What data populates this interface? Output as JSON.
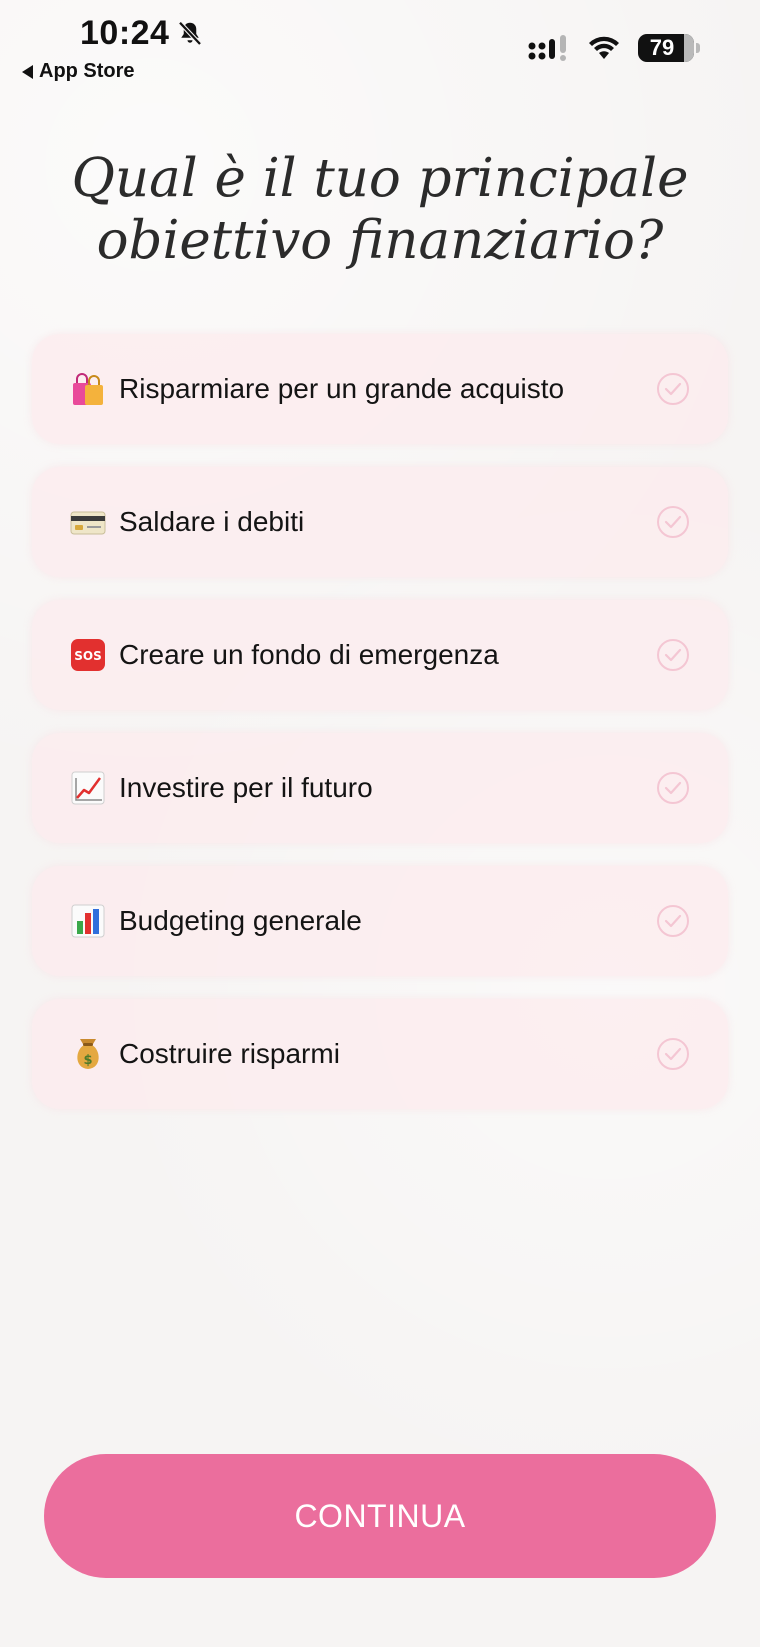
{
  "status_bar": {
    "time": "10:24",
    "back_label": "App Store",
    "battery": "79"
  },
  "title": "Qual è il tuo principale obiettivo finanziario?",
  "options": [
    {
      "emoji": "shopping-bags-icon",
      "label": "Risparmiare per un grande acquisto"
    },
    {
      "emoji": "credit-card-icon",
      "label": "Saldare i debiti"
    },
    {
      "emoji": "sos-icon",
      "label": "Creare un fondo di emergenza"
    },
    {
      "emoji": "chart-increasing-icon",
      "label": "Investire per il futuro"
    },
    {
      "emoji": "bar-chart-icon",
      "label": "Budgeting generale"
    },
    {
      "emoji": "money-bag-icon",
      "label": "Costruire risparmi"
    }
  ],
  "continue_label": "CONTINUA",
  "colors": {
    "accent": "#eb6e9d",
    "option_bg": "#fcebee",
    "check": "#f4c6d3"
  }
}
